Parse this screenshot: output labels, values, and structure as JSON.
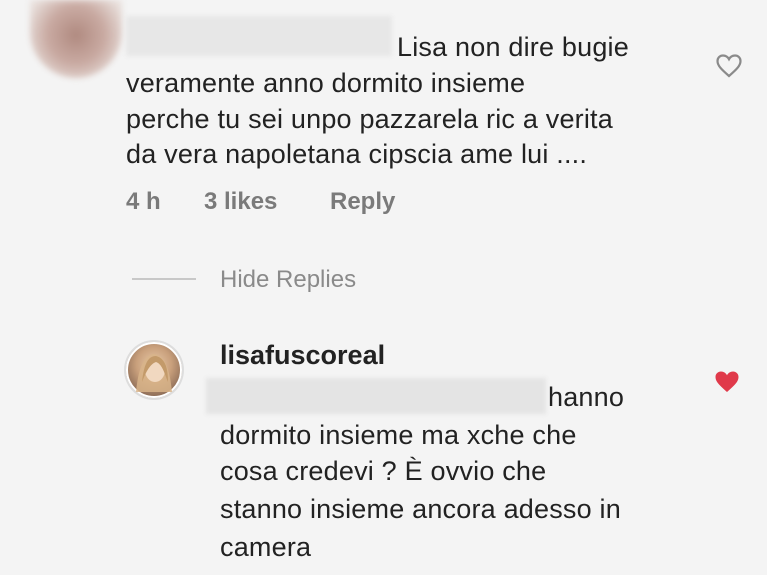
{
  "comment": {
    "text_line1": "Lisa non dire bugie",
    "text_rest": [
      "veramente anno dormito insieme",
      "perche tu sei unpo pazzarela ric a verita",
      "da vera napoletana cipscia ame lui ...."
    ],
    "time": "4 h",
    "likes": "3 likes",
    "reply_label": "Reply"
  },
  "thread": {
    "hide_replies_label": "Hide Replies"
  },
  "reply": {
    "username": "lisafuscoreal",
    "text_line1": "hanno",
    "text_rest": [
      "dormito insieme ma xche che",
      "cosa credevi ? È ovvio che",
      "stanno insieme ancora adesso in",
      "camera"
    ]
  },
  "icons": {
    "like_outline": "heart-outline-icon",
    "like_filled": "heart-filled-icon"
  },
  "colors": {
    "liked_heart": "#e0394a",
    "meta_text": "#7a7a7a"
  }
}
